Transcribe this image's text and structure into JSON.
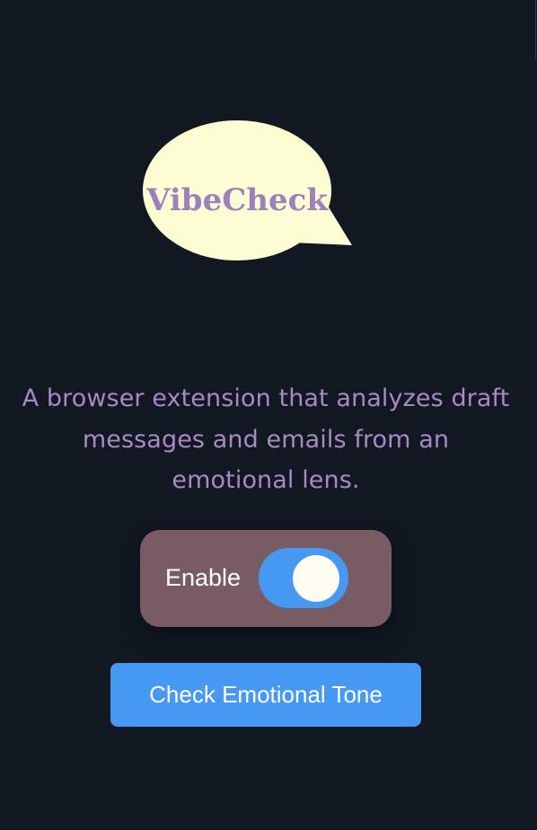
{
  "logo": {
    "text": "VibeCheck",
    "icon": "speech-bubble-icon",
    "bubble_color": "#fdfdd3",
    "text_color": "#a07fbf"
  },
  "description": "A browser extension that analyzes draft messages and emails from an emotional lens.",
  "toggle": {
    "label": "Enable",
    "enabled": true
  },
  "check_button": {
    "label": "Check Emotional Tone"
  },
  "colors": {
    "background": "#111822",
    "card": "#795b63",
    "accent": "#4699f3",
    "description_text": "#a889c4"
  }
}
